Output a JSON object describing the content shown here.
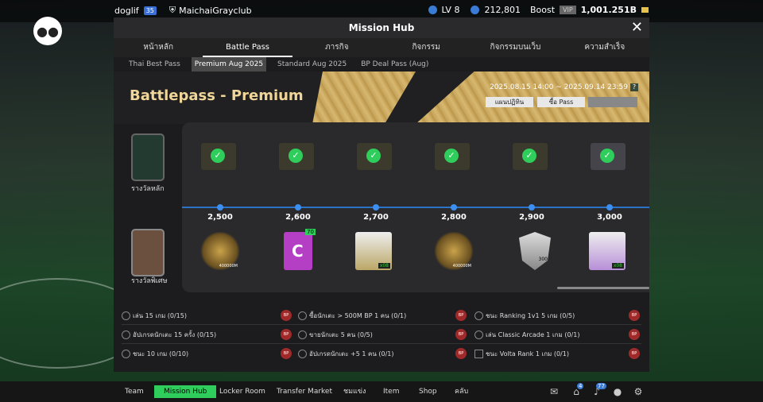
{
  "user": {
    "name": "doglif",
    "badge": "35",
    "club": "MaichaiGrayclub"
  },
  "status": {
    "level": "LV 8",
    "coins": "212,801",
    "boost_label": "Boost",
    "vip": "VIP",
    "balance": "1,001.251B"
  },
  "panel": {
    "title": "Mission Hub"
  },
  "tabs": [
    "หน้าหลัก",
    "Battle Pass",
    "ภารกิจ",
    "กิจกรรม",
    "กิจกรรมบนเว็บ",
    "ความสำเร็จ"
  ],
  "subtabs": [
    "Thai Best Pass",
    "Premium Aug 2025",
    "Standard Aug 2025",
    "BP Deal Pass (Aug)"
  ],
  "banner": {
    "title": "Battlepass - Premium",
    "dates": "2025.08.15 14:00 ~ 2025.09.14 23:59",
    "help": "?",
    "btn_calendar": "แผนปฏิทิน",
    "btn_buy": "ซื้อ Pass"
  },
  "rows": {
    "main_label": "รางวัลหลัก",
    "special_label": "รางวัลพิเศษ"
  },
  "milestones": [
    "2,500",
    "2,600",
    "2,700",
    "2,800",
    "2,900",
    "3,000"
  ],
  "special_rewards": [
    {
      "icon": "coin-bag-icon",
      "note": "400000M"
    },
    {
      "icon": "training-book-icon",
      "label": "C",
      "badge": "70"
    },
    {
      "icon": "player-pack-icon",
      "note": "x08"
    },
    {
      "icon": "coin-bag-icon",
      "note": "400000M"
    },
    {
      "icon": "shield-icon",
      "note": "300"
    },
    {
      "icon": "player-pack-icon",
      "note": "x08"
    }
  ],
  "missions": [
    {
      "text": "เล่น 15 เกม (0/15)"
    },
    {
      "text": "ซื้อนักเตะ > 500M BP 1 คน (0/1)"
    },
    {
      "text": "ชนะ Ranking 1v1 5 เกม (0/5)"
    },
    {
      "text": "อัปเกรดนักเตะ 15 ครั้ง (0/15)"
    },
    {
      "text": "ขายนักเตะ 5 คน (0/5)"
    },
    {
      "text": "เล่น Classic Arcade 1 เกม (0/1)"
    },
    {
      "text": "ชนะ 10 เกม (0/10)"
    },
    {
      "text": "อัปเกรดนักเตะ +5 1 คน (0/1)"
    },
    {
      "text": "ชนะ Volta Rank 1 เกม (0/1)"
    }
  ],
  "bottom_nav": [
    "Team",
    "Mission Hub",
    "Locker Room",
    "Transfer Market",
    "ชมแข่ง",
    "Item",
    "Shop",
    "คลับ"
  ],
  "bottom_badges": {
    "home": "4",
    "notify": "77"
  }
}
